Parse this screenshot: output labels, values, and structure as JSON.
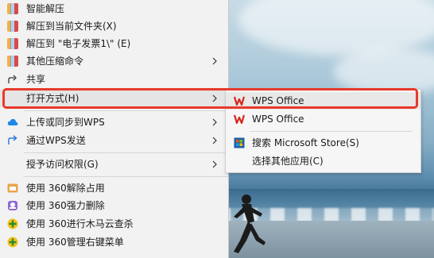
{
  "context_menu": {
    "items": [
      {
        "label": "智能解压",
        "icon": "archive-icon"
      },
      {
        "label": "解压到当前文件夹(X)",
        "icon": "archive-icon"
      },
      {
        "label": "解压到 \"电子发票1\\\" (E)",
        "icon": "archive-icon"
      },
      {
        "label": "其他压缩命令",
        "icon": "archive-icon",
        "submenu": true
      },
      {
        "label": "共享",
        "icon": "share-icon"
      },
      {
        "label": "打开方式(H)",
        "submenu": true,
        "active": true
      },
      {
        "label": "上传或同步到WPS",
        "icon": "cloud-icon",
        "submenu": true
      },
      {
        "label": "通过WPS发送",
        "icon": "send-icon",
        "submenu": true
      },
      {
        "label": "授予访问权限(G)",
        "submenu": true
      },
      {
        "label": "使用 360解除占用",
        "icon": "360-unlock-icon"
      },
      {
        "label": "使用 360强力删除",
        "icon": "360-delete-icon"
      },
      {
        "label": "使用 360进行木马云查杀",
        "icon": "360-scan-icon"
      },
      {
        "label": "使用 360管理右键菜单",
        "icon": "360-menu-icon"
      }
    ]
  },
  "open_with_submenu": {
    "items": [
      {
        "label": "WPS Office",
        "icon": "wps-icon"
      },
      {
        "label": "WPS Office",
        "icon": "wps-icon"
      },
      {
        "label": "搜索 Microsoft Store(S)",
        "icon": "store-icon"
      },
      {
        "label": "选择其他应用(C)"
      }
    ]
  },
  "colors": {
    "highlight_border": "#e8392b",
    "menu_bg": "#f2f2f2",
    "wps_red": "#d6281f"
  }
}
